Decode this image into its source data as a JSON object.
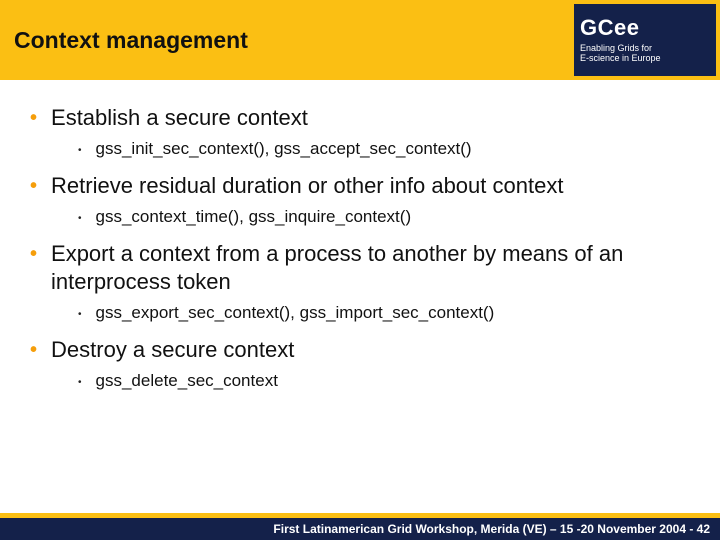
{
  "header": {
    "title": "Context management"
  },
  "logo": {
    "big": "GC",
    "small": "ee",
    "tag1": "Enabling Grids for",
    "tag2": "E-science in Europe"
  },
  "bullets": [
    {
      "text": "Establish a secure context",
      "sub": [
        "gss_init_sec_context(), gss_accept_sec_context()"
      ]
    },
    {
      "text": "Retrieve residual duration or other info about context",
      "sub": [
        "gss_context_time(), gss_inquire_context()"
      ]
    },
    {
      "text": "Export a context from a process to another by means of an interprocess token",
      "sub": [
        "gss_export_sec_context(), gss_import_sec_context()"
      ]
    },
    {
      "text": "Destroy a secure context",
      "sub": [
        "gss_delete_sec_context"
      ]
    }
  ],
  "footer": {
    "text": "First Latinamerican Grid Workshop, Merida (VE) – 15 -20 November 2004 - 42"
  },
  "colors": {
    "gold": "#fbbf13",
    "navy": "#14214a",
    "bullet": "#f59e0b"
  }
}
